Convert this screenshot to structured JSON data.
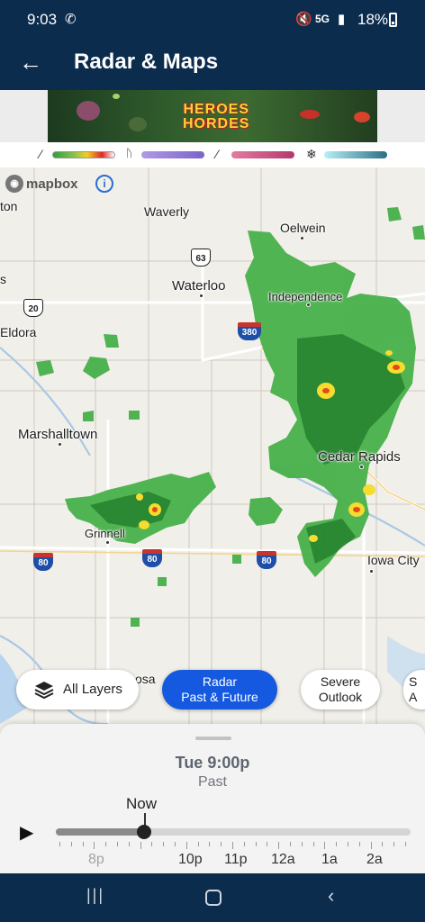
{
  "status_bar": {
    "time": "9:03",
    "missed_call_icon": "missed-call-icon",
    "mute_icon": "vibrate-off-icon",
    "network": "5G",
    "battery": "18%"
  },
  "app_bar": {
    "back_icon": "arrow-left-icon",
    "title": "Radar & Maps"
  },
  "ad": {
    "title_line1": "HEROES",
    "title_line2": "HORDES"
  },
  "legend": {
    "items": [
      {
        "icon": "rain-icon",
        "glyph": "⁄",
        "colors": [
          "#2f9e3a",
          "#f4d01d",
          "#e02626",
          "#ffffff"
        ]
      },
      {
        "icon": "mix-icon",
        "glyph": "ᚢ",
        "colors": [
          "#a68ae0",
          "#7b64c9"
        ]
      },
      {
        "icon": "sleet-icon",
        "glyph": "⁄",
        "colors": [
          "#e3799f",
          "#b23a6e"
        ]
      },
      {
        "icon": "snowflake-icon",
        "glyph": "❄",
        "colors": [
          "#a8eaf3",
          "#2b6e86"
        ]
      }
    ]
  },
  "map": {
    "attribution": "mapbox",
    "info_label": "i",
    "cities": [
      "ton",
      "Waverly",
      "Oelwein",
      "Waterloo",
      "Independence",
      "Eldora",
      "s",
      "Marshalltown",
      "Cedar Rapids",
      "Grinnell",
      "Iowa City",
      "osa"
    ],
    "shields": [
      {
        "type": "us",
        "label": "63"
      },
      {
        "type": "us",
        "label": "20"
      },
      {
        "type": "interstate",
        "label": "380"
      },
      {
        "type": "interstate",
        "label": "80"
      },
      {
        "type": "interstate",
        "label": "80"
      },
      {
        "type": "interstate",
        "label": "80"
      }
    ]
  },
  "layers": {
    "all_layers": "All Layers",
    "radar_line1": "Radar",
    "radar_line2": "Past & Future",
    "severe_line1": "Severe",
    "severe_line2": "Outlook",
    "next_line1": "S",
    "next_line2": "A"
  },
  "timeline": {
    "current_time": "Tue 9:00p",
    "mode": "Past",
    "now_label": "Now",
    "play_icon": "play-icon",
    "labels": [
      "8p",
      "10p",
      "11p",
      "12a",
      "1a",
      "2a"
    ],
    "progress": 0.25
  },
  "nav": {
    "recents_icon": "recents-icon",
    "home_icon": "home-icon",
    "back_icon": "nav-back-icon"
  }
}
